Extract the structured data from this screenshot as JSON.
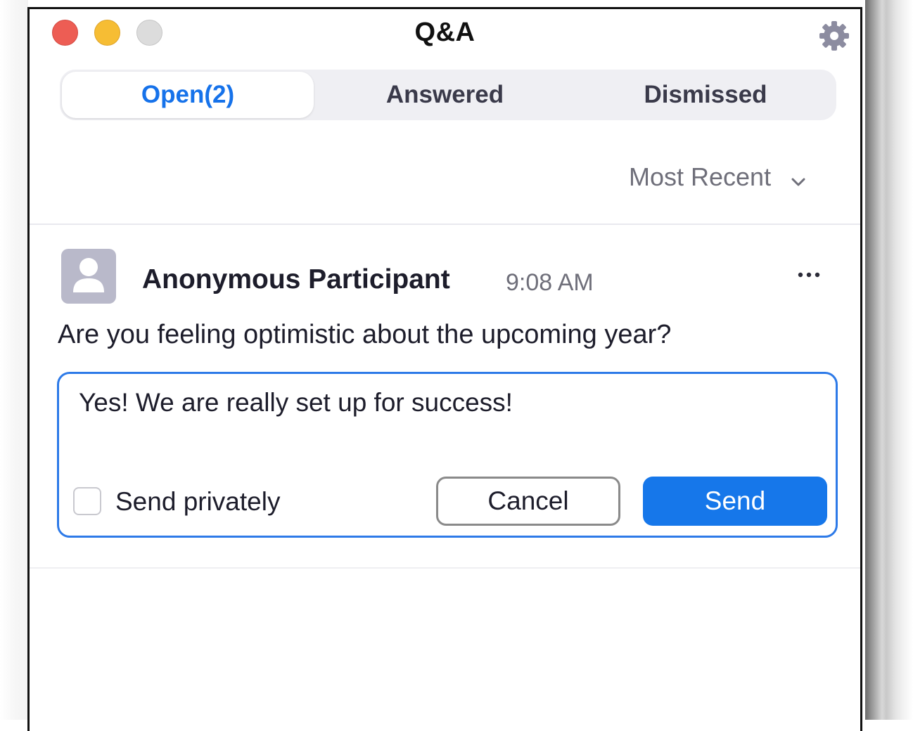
{
  "window": {
    "title": "Q&A"
  },
  "tabs": [
    {
      "label": "Open(2)",
      "selected": true
    },
    {
      "label": "Answered",
      "selected": false
    },
    {
      "label": "Dismissed",
      "selected": false
    }
  ],
  "sort": {
    "label": "Most Recent",
    "icon": "chevron-down-icon"
  },
  "question": {
    "author": "Anonymous Participant",
    "time": "9:08 AM",
    "text": "Are you feeling optimistic about the upcoming year?",
    "menu_icon": "more-icon"
  },
  "reply": {
    "value": "Yes! We are really set up for success!",
    "send_privately_label": "Send privately",
    "send_privately_checked": false,
    "cancel_label": "Cancel",
    "send_label": "Send"
  },
  "colors": {
    "accent": "#1672ea",
    "close": "#ed5d54",
    "minimize": "#f6bd34",
    "zoom": "#dcdcdc",
    "avatar": "#b9b9ca"
  }
}
